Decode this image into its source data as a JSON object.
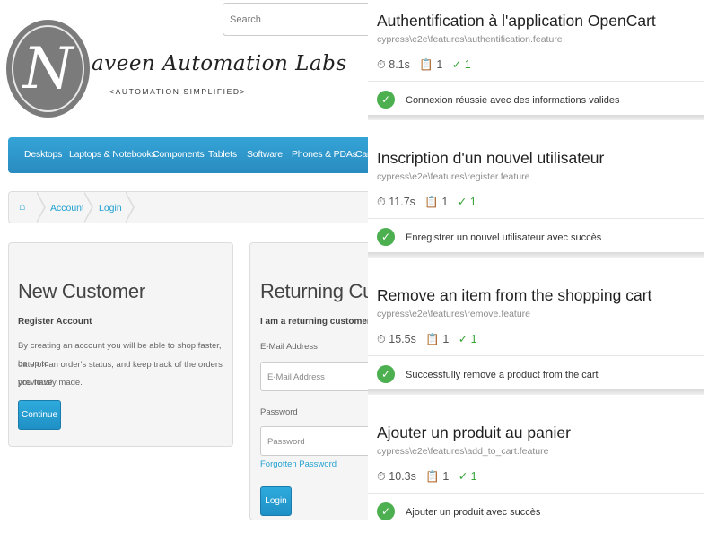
{
  "opencart": {
    "search_placeholder": "Search",
    "logo": {
      "initial": "N",
      "name": "aveen Automation Labs",
      "tagline": "<AUTOMATION SIMPLIFIED>"
    },
    "menu": [
      "Desktops",
      "Laptops & Notebooks",
      "Components",
      "Tablets",
      "Software",
      "Phones & PDAs",
      "Cam"
    ],
    "breadcrumb": {
      "account": "Account",
      "login": "Login"
    },
    "new_customer": {
      "title": "New Customer",
      "subtitle": "Register Account",
      "line1": "By creating an account you will be able to shop faster, be up to",
      "line2": "date on an order's status, and keep track of the orders you have",
      "line3": "previously made.",
      "button": "Continue"
    },
    "returning": {
      "title": "Returning Custo",
      "subtitle": "I am a returning customer",
      "email_label": "E-Mail Address",
      "email_placeholder": "E-Mail Address",
      "password_label": "Password",
      "password_placeholder": "Password",
      "forgot": "Forgotten Password",
      "button": "Login"
    }
  },
  "report": {
    "cards": [
      {
        "title": "Authentification à l'application OpenCart",
        "path": "cypress\\e2e\\features\\authentification.feature",
        "duration": "8.1s",
        "tests": "1",
        "passed": "1",
        "test": "Connexion réussie avec des informations valides"
      },
      {
        "title": "Inscription d'un nouvel utilisateur",
        "path": "cypress\\e2e\\features\\register.feature",
        "duration": "11.7s",
        "tests": "1",
        "passed": "1",
        "test": "Enregistrer un nouvel utilisateur avec succès"
      },
      {
        "title": "Remove an item from the shopping cart",
        "path": "cypress\\e2e\\features\\remove.feature",
        "duration": "15.5s",
        "tests": "1",
        "passed": "1",
        "test": "Successfully remove a product from the cart"
      },
      {
        "title": "Ajouter un produit au panier",
        "path": "cypress\\e2e\\features\\add_to_cart.feature",
        "duration": "10.3s",
        "tests": "1",
        "passed": "1",
        "test": "Ajouter un produit avec succès"
      }
    ]
  },
  "colors": {
    "menu": "#2a8cc0",
    "link": "#23a1d1",
    "pass": "#4caf50"
  }
}
